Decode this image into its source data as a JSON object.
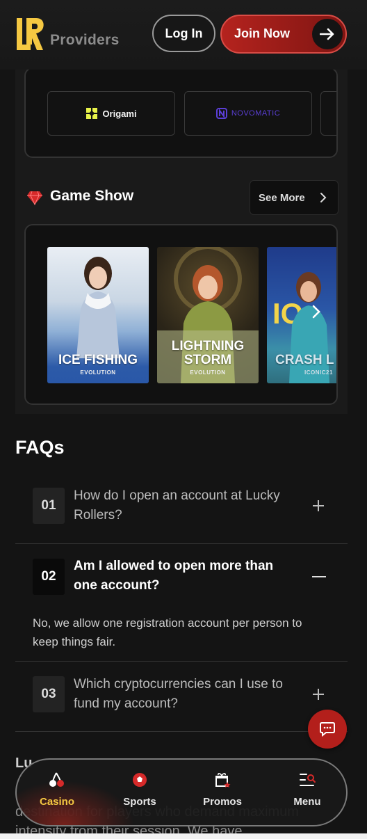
{
  "header": {
    "logo_text": "LR",
    "section_title": "Providers",
    "login_label": "Log In",
    "join_label": "Join Now"
  },
  "providers": [
    {
      "name": "Origami"
    },
    {
      "name": "NOVOMATIC"
    }
  ],
  "game_show": {
    "title": "Game Show",
    "see_more_label": "See More",
    "games": [
      {
        "title": "ICE FISHING",
        "provider": "EVOLUTION"
      },
      {
        "title": "LIGHTNING STORM",
        "title_line1": "LIGHTNING",
        "title_line2": "STORM",
        "provider": "EVOLUTION"
      },
      {
        "title": "CRASH L",
        "provider": "ICONIC21"
      }
    ]
  },
  "faq": {
    "title": "FAQs",
    "items": [
      {
        "number": "01",
        "question": "How do I open an account at Lucky Rollers?",
        "expanded": false
      },
      {
        "number": "02",
        "question": "Am I allowed to open more than one account?",
        "expanded": true,
        "answer": "No, we allow one registration account per person to keep things fair."
      },
      {
        "number": "03",
        "question": "Which cryptocurrencies can I use to fund my account?",
        "expanded": false
      }
    ]
  },
  "about": {
    "heading_partial": "Lu",
    "text_partial": "destination for players who demand maximum intensity from their session. We have"
  },
  "bottom_nav": {
    "items": [
      {
        "label": "Casino",
        "icon": "cherries-icon",
        "active": true
      },
      {
        "label": "Sports",
        "icon": "ball-icon",
        "active": false
      },
      {
        "label": "Promos",
        "icon": "gift-icon",
        "active": false
      },
      {
        "label": "Menu",
        "icon": "menu-search-icon",
        "active": false
      }
    ]
  },
  "colors": {
    "brand_red": "#b31f1b",
    "brand_yellow": "#f5c842",
    "background": "#141414"
  }
}
